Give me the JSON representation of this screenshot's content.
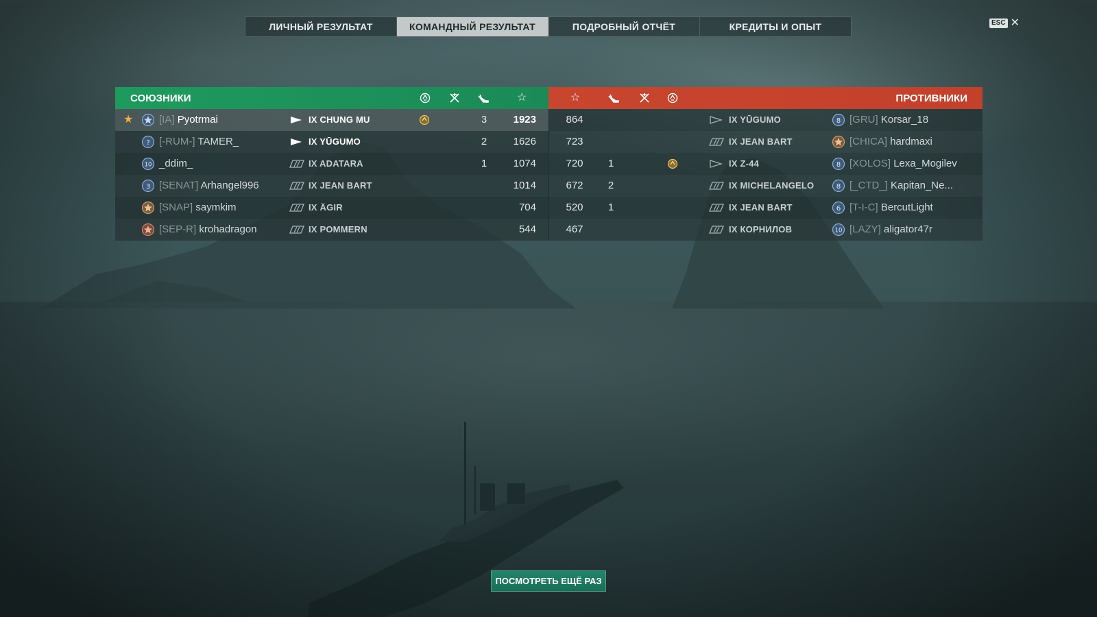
{
  "tabs": [
    {
      "label": "ЛИЧНЫЙ РЕЗУЛЬТАТ",
      "active": false
    },
    {
      "label": "КОМАНДНЫЙ РЕЗУЛЬТАТ",
      "active": true
    },
    {
      "label": "ПОДРОБНЫЙ ОТЧЁТ",
      "active": false
    },
    {
      "label": "КРЕДИТЫ И ОПЫТ",
      "active": false
    }
  ],
  "esc": {
    "key": "ESC",
    "icon": "close-icon"
  },
  "allies": {
    "title": "СОЮЗНИКИ",
    "color": "#1e9a5e",
    "column_icons": [
      "base-capture-icon",
      "planes-destroyed-icon",
      "ships-destroyed-icon",
      "experience-star-icon"
    ],
    "rows": [
      {
        "best": true,
        "rank": "",
        "clan": "[IA]",
        "name": "Pyotrmai",
        "ship": "IX CHUNG MU",
        "base_icon": true,
        "planes": "",
        "kills": "3",
        "xp": "1923"
      },
      {
        "best": false,
        "rank": "?",
        "clan": "[-RUM-]",
        "name": "TAMER_",
        "ship": "IX YŪGUMO",
        "base_icon": false,
        "planes": "",
        "kills": "2",
        "xp": "1626"
      },
      {
        "best": false,
        "rank": "10",
        "clan": "",
        "name": "_ddim_",
        "ship": "IX ADATARA",
        "base_icon": false,
        "planes": "",
        "kills": "1",
        "xp": "1074"
      },
      {
        "best": false,
        "rank": "3",
        "clan": "[SENAT]",
        "name": "Arhangel996",
        "ship": "IX JEAN BART",
        "base_icon": false,
        "planes": "",
        "kills": "",
        "xp": "1014"
      },
      {
        "best": false,
        "rank": "",
        "clan": "[SNAP]",
        "name": "saymkim",
        "ship": "IX ÄGIR",
        "base_icon": false,
        "planes": "",
        "kills": "",
        "xp": "704"
      },
      {
        "best": false,
        "rank": "",
        "clan": "[SEP-R]",
        "name": "krohadragon",
        "ship": "IX POMMERN",
        "base_icon": false,
        "planes": "",
        "kills": "",
        "xp": "544"
      }
    ]
  },
  "enemies": {
    "title": "ПРОТИВНИКИ",
    "color": "#c8452e",
    "column_icons": [
      "experience-star-icon",
      "ships-destroyed-icon",
      "planes-destroyed-icon",
      "base-capture-icon"
    ],
    "rows": [
      {
        "rank": "8",
        "clan": "[GRU]",
        "name": "Korsar_18",
        "ship": "IX YŪGUMO",
        "xp": "864",
        "kills": "",
        "base_icon": false
      },
      {
        "rank": "",
        "clan": "[CHICA]",
        "name": "hardmaxi",
        "ship": "IX JEAN BART",
        "xp": "723",
        "kills": "",
        "base_icon": false
      },
      {
        "rank": "8",
        "clan": "[XOLOS]",
        "name": "Lexa_Mogilev",
        "ship": "IX Z-44",
        "xp": "720",
        "kills": "1",
        "base_icon": true
      },
      {
        "rank": "8",
        "clan": "[_CTD_]",
        "name": "Kapitan_Ne...",
        "ship": "IX MICHELANGELO",
        "xp": "672",
        "kills": "2",
        "base_icon": false
      },
      {
        "rank": "6",
        "clan": "[T-I-C]",
        "name": "BercutLight",
        "ship": "IX JEAN BART",
        "xp": "520",
        "kills": "1",
        "base_icon": false
      },
      {
        "rank": "10",
        "clan": "[LAZY]",
        "name": "aligator47r",
        "ship": "IX КОРНИЛОВ",
        "xp": "467",
        "kills": "",
        "base_icon": false
      }
    ]
  },
  "replay_button": "ПОСМОТРЕТЬ ЕЩЁ РАЗ"
}
